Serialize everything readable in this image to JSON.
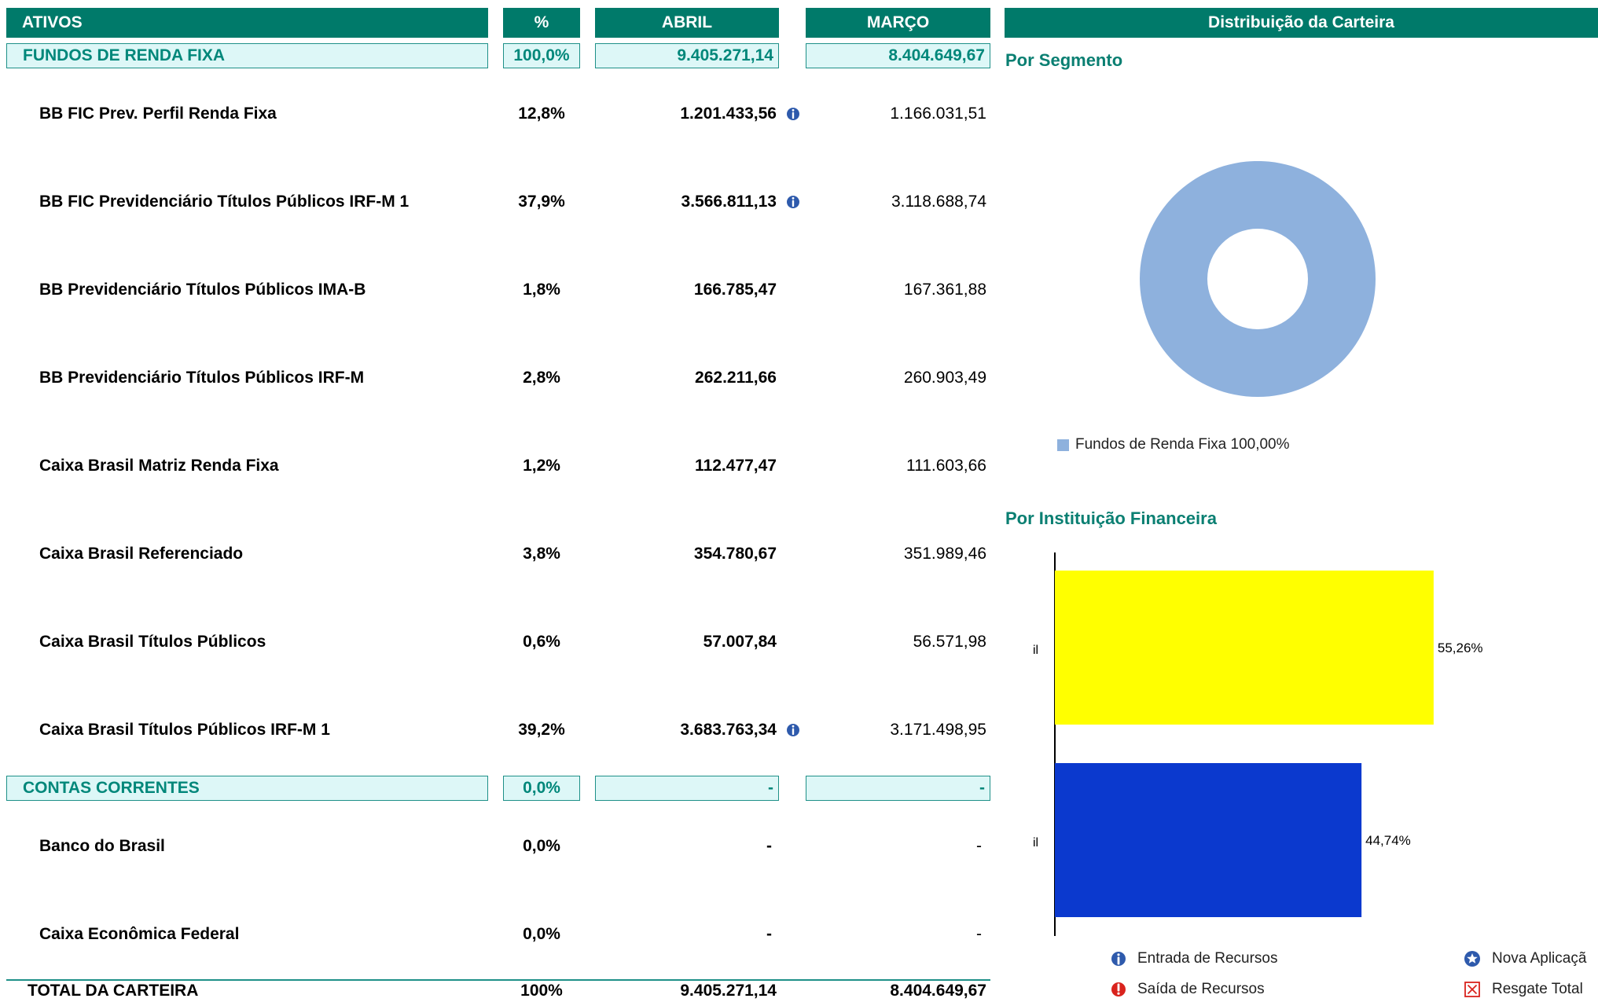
{
  "table": {
    "headers": {
      "ativos": "ATIVOS",
      "pct": "%",
      "abril": "ABRIL",
      "marco": "MARÇO"
    },
    "categories": [
      {
        "name": "FUNDOS DE RENDA FIXA",
        "pct": "100,0%",
        "abril": "9.405.271,14",
        "marco": "8.404.649,67"
      },
      {
        "name": "CONTAS CORRENTES",
        "pct": "0,0%",
        "abril": "-",
        "marco": "-"
      }
    ],
    "funds": [
      {
        "name": "BB FIC Prev. Perfil Renda Fixa",
        "pct": "12,8%",
        "abril": "1.201.433,56",
        "marco": "1.166.031,51",
        "icon": "entrada-icon"
      },
      {
        "name": "BB FIC Previdenciário Títulos Públicos IRF-M 1",
        "pct": "37,9%",
        "abril": "3.566.811,13",
        "marco": "3.118.688,74",
        "icon": "entrada-icon"
      },
      {
        "name": "BB Previdenciário Títulos Públicos IMA-B",
        "pct": "1,8%",
        "abril": "166.785,47",
        "marco": "167.361,88"
      },
      {
        "name": "BB Previdenciário Títulos Públicos IRF-M",
        "pct": "2,8%",
        "abril": "262.211,66",
        "marco": "260.903,49"
      },
      {
        "name": "Caixa Brasil Matriz Renda Fixa",
        "pct": "1,2%",
        "abril": "112.477,47",
        "marco": "111.603,66"
      },
      {
        "name": "Caixa Brasil Referenciado",
        "pct": "3,8%",
        "abril": "354.780,67",
        "marco": "351.989,46"
      },
      {
        "name": "Caixa Brasil Títulos Públicos",
        "pct": "0,6%",
        "abril": "57.007,84",
        "marco": "56.571,98"
      },
      {
        "name": "Caixa Brasil Títulos Públicos IRF-M 1",
        "pct": "39,2%",
        "abril": "3.683.763,34",
        "marco": "3.171.498,95",
        "icon": "entrada-icon"
      }
    ],
    "accounts": [
      {
        "name": "Banco do Brasil",
        "pct": "0,0%",
        "abril": "-",
        "marco": "-"
      },
      {
        "name": "Caixa Econômica Federal",
        "pct": "0,0%",
        "abril": "-",
        "marco": "-"
      }
    ],
    "total": {
      "label": "TOTAL DA CARTEIRA",
      "pct": "100%",
      "abril": "9.405.271,14",
      "marco": "8.404.649,67"
    }
  },
  "right_panel": {
    "header": "Distribuição da Carteira",
    "segment_title": "Por Segmento",
    "institution_title": "Por Instituição Financeira"
  },
  "chart_data": [
    {
      "type": "pie",
      "title": "Por Segmento",
      "categories": [
        "Fundos de Renda Fixa"
      ],
      "values": [
        100.0
      ],
      "legend_labels": [
        "Fundos de Renda Fixa 100,00%"
      ],
      "colors": [
        "#8EB1DD"
      ],
      "legend": "bottom"
    },
    {
      "type": "bar",
      "orientation": "horizontal",
      "title": "Por Instituição Financeira",
      "categories": [
        "il",
        "il"
      ],
      "values": [
        55.26,
        44.74
      ],
      "data_labels": [
        "55,26%",
        "44,74%"
      ],
      "colors": [
        "#FFFF00",
        "#0B39CE"
      ],
      "xlim": [
        0,
        100
      ]
    }
  ],
  "legend": {
    "entrada": "Entrada de Recursos",
    "saida": "Saída de Recursos",
    "nova": "Nova Aplicaçã",
    "resgate": "Resgate Total"
  },
  "colors": {
    "header": "#007A6A",
    "category_bg": "#DDF7F7",
    "category_text": "#00877A",
    "icon_blue": "#2E5AAC",
    "icon_red": "#D9231D"
  }
}
